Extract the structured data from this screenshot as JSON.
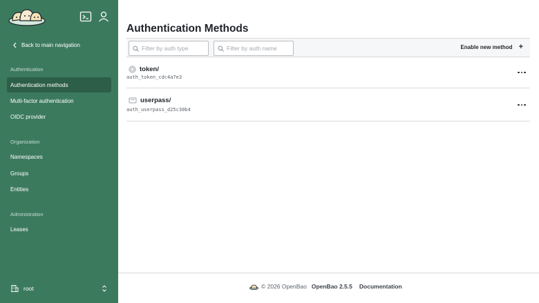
{
  "sidebar": {
    "back_label": "Back to main navigation",
    "sections": [
      {
        "label": "Authentication",
        "items": [
          "Authentication methods",
          "Multi-factor authentication",
          "OIDC provider"
        ]
      },
      {
        "label": "Organization",
        "items": [
          "Namespaces",
          "Groups",
          "Entities"
        ]
      },
      {
        "label": "Administration",
        "items": [
          "Leases"
        ]
      }
    ],
    "active_item": "Authentication methods",
    "namespace": "root",
    "icons": {
      "console": "terminal-icon",
      "user": "user-icon",
      "namespace": "building-icon",
      "switch": "chevron-up-down-icon"
    }
  },
  "main": {
    "title": "Authentication Methods",
    "filter_type_placeholder": "Filter by auth type",
    "filter_name_placeholder": "Filter by auth name",
    "enable_label": "Enable new method",
    "enable_icon": "+",
    "methods": [
      {
        "path": "token/",
        "accessor": "auth_token_cdc4a7e3",
        "icon": "token-icon"
      },
      {
        "path": "userpass/",
        "accessor": "auth_userpass_d25c30b4",
        "icon": "userpass-icon"
      }
    ]
  },
  "footer": {
    "copyright": "© 2026 OpenBao",
    "version": "OpenBao 2.5.5",
    "docs": "Documentation"
  },
  "colors": {
    "sidebar": "#3c7a5e",
    "sidebar_active": "#2d5e47",
    "text": "#1f2328"
  }
}
